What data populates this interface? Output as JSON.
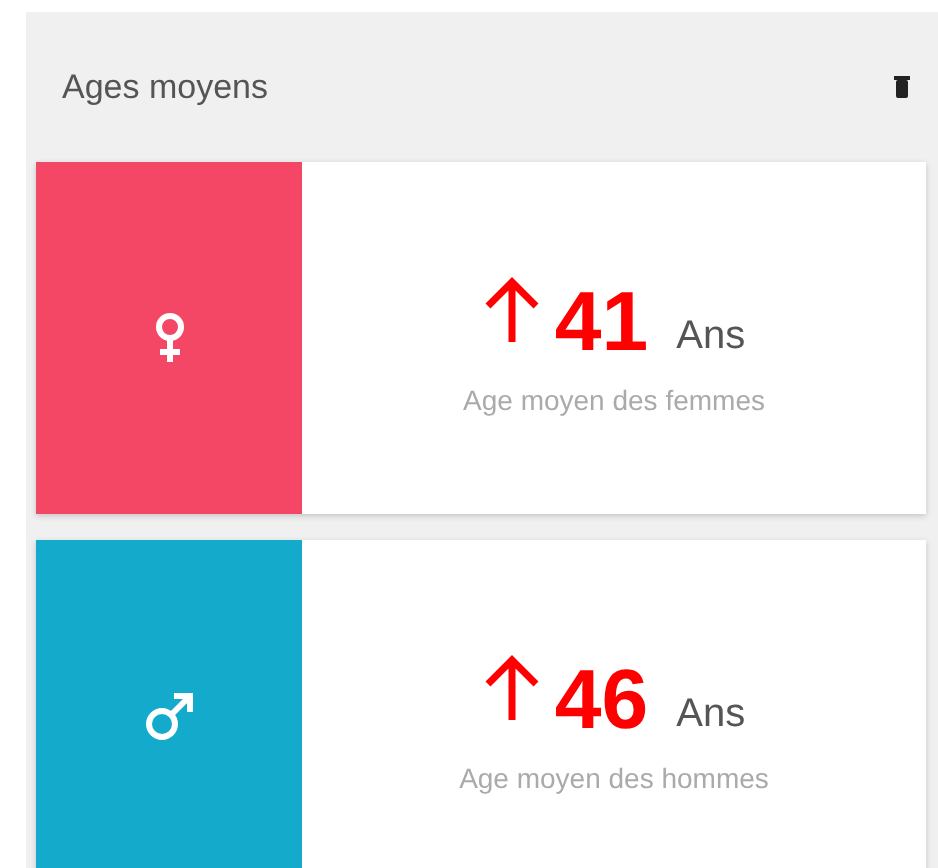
{
  "panel": {
    "title": "Ages moyens"
  },
  "cards": [
    {
      "kind": "female",
      "color": "#f44765",
      "rising": true,
      "value": "41",
      "unit": "Ans",
      "caption": "Age moyen des femmes"
    },
    {
      "kind": "male",
      "color": "#14aacb",
      "rising": true,
      "value": "46",
      "unit": "Ans",
      "caption": "Age moyen des hommes"
    }
  ]
}
